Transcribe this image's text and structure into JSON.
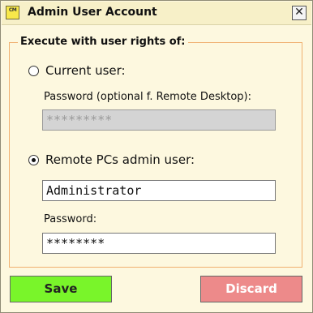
{
  "window": {
    "title": "Admin User Account",
    "icon_text": "CM",
    "close_glyph": "✕"
  },
  "group": {
    "legend": "Execute with user rights of:"
  },
  "current_user": {
    "label": "Current user:",
    "selected": false,
    "password_label": "Password (optional f. Remote Desktop):",
    "password_value": "*********",
    "password_disabled": true
  },
  "remote_admin": {
    "label": "Remote PCs admin user:",
    "selected": true,
    "username_value": "Administrator",
    "password_label": "Password:",
    "password_value": "********"
  },
  "buttons": {
    "save": "Save",
    "discard": "Discard"
  },
  "colors": {
    "window_bg": "#fdf8df",
    "group_border": "#f0b070",
    "save_bg": "#79f52a",
    "discard_bg": "#ed8a8a"
  }
}
